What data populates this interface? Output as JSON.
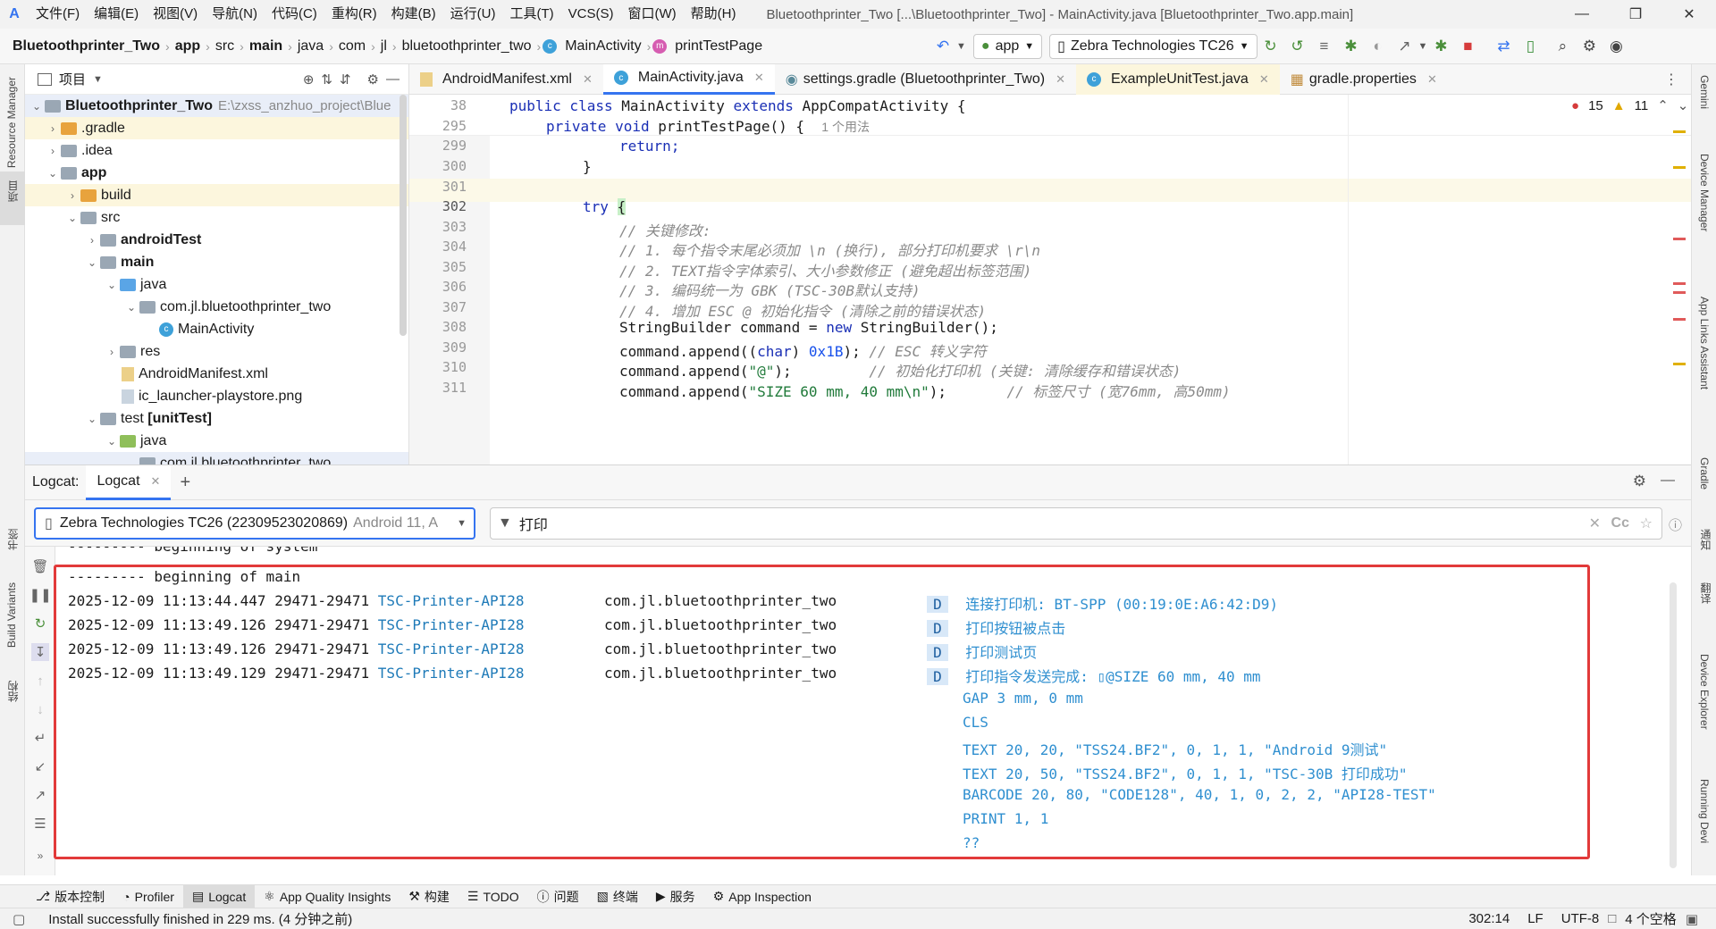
{
  "menubar": {
    "items": [
      "文件(F)",
      "编辑(E)",
      "视图(V)",
      "导航(N)",
      "代码(C)",
      "重构(R)",
      "构建(B)",
      "运行(U)",
      "工具(T)",
      "VCS(S)",
      "窗口(W)",
      "帮助(H)"
    ],
    "window_title": "Bluetoothprinter_Two [...\\Bluetoothprinter_Two] - MainActivity.java [Bluetoothprinter_Two.app.main]"
  },
  "navbar": {
    "crumbs": [
      "Bluetoothprinter_Two",
      "app",
      "src",
      "main",
      "java",
      "com",
      "jl",
      "bluetoothprinter_two",
      "MainActivity",
      "printTestPage"
    ],
    "run_config": "app",
    "device": "Zebra Technologies TC26"
  },
  "project": {
    "header": "项目",
    "root_name": "Bluetoothprinter_Two",
    "root_path": "E:\\zxss_anzhuo_project\\Blue",
    "items": [
      ".gradle",
      ".idea",
      "app",
      "build",
      "src",
      "androidTest",
      "main",
      "java",
      "com.jl.bluetoothprinter_two",
      "MainActivity",
      "res",
      "AndroidManifest.xml",
      "ic_launcher-playstore.png",
      "test",
      "[unitTest]",
      "java",
      "com.jl.bluetoothprinter_two"
    ]
  },
  "left_strip": [
    "Resource Manager",
    "项目",
    "书签",
    "Build Variants",
    "结构"
  ],
  "right_strip": [
    "Gemini",
    "Device Manager",
    "App Links Assistant",
    "Gradle",
    "通知",
    "翻译",
    "Device Explorer",
    "Running Devi"
  ],
  "tabs": [
    "AndroidManifest.xml",
    "MainActivity.java",
    "settings.gradle (Bluetoothprinter_Two)",
    "ExampleUnitTest.java",
    "gradle.properties"
  ],
  "editor": {
    "errors": "15",
    "warnings": "11",
    "line_numbers": [
      "38",
      "295",
      "299",
      "300",
      "301",
      "302",
      "303",
      "304",
      "305",
      "306",
      "307",
      "308",
      "309",
      "310",
      "311"
    ],
    "usage_hint": "1 个用法",
    "code": {
      "l38_a": "public class ",
      "l38_b": "MainActivity ",
      "l38_c": "extends ",
      "l38_d": "AppCompatActivity {",
      "l295_a": "private void ",
      "l295_b": "printTestPage() {",
      "l299": "return;",
      "l300": "}",
      "l302_a": "try ",
      "l302_b": "{",
      "l303": "// 关键修改:",
      "l304": "// 1. 每个指令末尾必须加 \\n (换行), 部分打印机要求 \\r\\n",
      "l305": "// 2. TEXT指令字体索引、大小参数修正 (避免超出标签范围)",
      "l306": "// 3. 编码统一为 GBK (TSC-30B默认支持)",
      "l307": "// 4. 增加 ESC @ 初始化指令 (清除之前的错误状态)",
      "l308_a": "StringBuilder command = ",
      "l308_b": "new ",
      "l308_c": "StringBuilder();",
      "l309_a": "command.append((",
      "l309_b": "char",
      "l309_c": ") ",
      "l309_d": "0x1B",
      "l309_e": "); ",
      "l309_f": "// ESC 转义字符",
      "l310_a": "command.append(",
      "l310_b": "\"@\"",
      "l310_c": ");",
      "l310_d": "// 初始化打印机 (关键: 清除缓存和错误状态)",
      "l311_a": "command.append(",
      "l311_b": "\"SIZE 60 mm, 40 mm\\n\"",
      "l311_c": ");",
      "l311_d": "// 标签尺寸 (宽76mm, 高50mm)"
    }
  },
  "logcat": {
    "label": "Logcat:",
    "tab": "Logcat",
    "device_name": "Zebra Technologies TC26 (22309523020869)",
    "device_os": "Android 11, A",
    "filter_text": "打印",
    "case_btn": "Cc",
    "lines": {
      "sys": "--------- beginning of system",
      "main": "--------- beginning of main"
    },
    "entries": [
      {
        "time": "2025-12-09 11:13:44.447 29471-29471",
        "tag": "TSC-Printer-API28",
        "pkg": "com.jl.bluetoothprinter_two",
        "level": "D",
        "msg": "连接打印机: BT-SPP (00:19:0E:A6:42:D9)"
      },
      {
        "time": "2025-12-09 11:13:49.126 29471-29471",
        "tag": "TSC-Printer-API28",
        "pkg": "com.jl.bluetoothprinter_two",
        "level": "D",
        "msg": "打印按钮被点击"
      },
      {
        "time": "2025-12-09 11:13:49.126 29471-29471",
        "tag": "TSC-Printer-API28",
        "pkg": "com.jl.bluetoothprinter_two",
        "level": "D",
        "msg": "打印测试页"
      },
      {
        "time": "2025-12-09 11:13:49.129 29471-29471",
        "tag": "TSC-Printer-API28",
        "pkg": "com.jl.bluetoothprinter_two",
        "level": "D",
        "msg": "打印指令发送完成: ▯@SIZE 60 mm, 40 mm"
      }
    ],
    "continuation": [
      "GAP 3 mm, 0 mm",
      "CLS",
      "TEXT 20, 20, \"TSS24.BF2\", 0, 1, 1, \"Android 9测试\"",
      "TEXT 20, 50, \"TSS24.BF2\", 0, 1, 1, \"TSC-30B 打印成功\"",
      "BARCODE 20, 80, \"CODE128\", 40, 1, 0, 2, 2, \"API28-TEST\"",
      "PRINT 1, 1",
      "??"
    ]
  },
  "bottom_tools": [
    "版本控制",
    "Profiler",
    "Logcat",
    "App Quality Insights",
    "构建",
    "TODO",
    "问题",
    "终端",
    "服务",
    "App Inspection"
  ],
  "status": {
    "message": "Install successfully finished in 229 ms. (4 分钟之前)",
    "position": "302:14",
    "line_sep": "LF",
    "encoding": "UTF-8",
    "indent": "4 个空格"
  },
  "colors": {
    "accent": "#3574f0",
    "highlight_box": "#e23a3a",
    "log_message": "#2f8fd0"
  }
}
